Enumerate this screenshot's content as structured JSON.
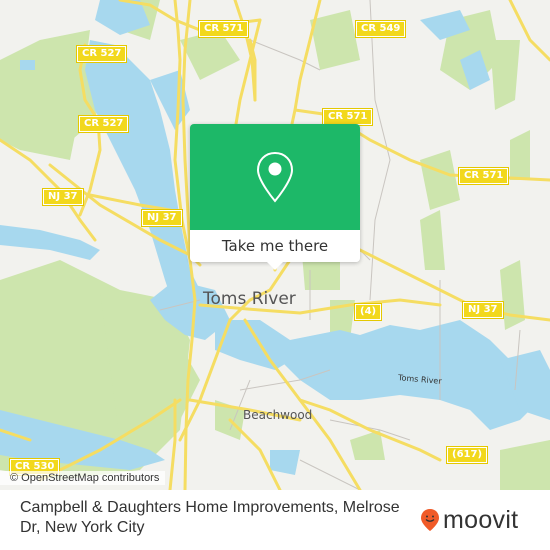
{
  "map": {
    "colors": {
      "land": "#f2f2ee",
      "water": "#a7d8ee",
      "park": "#cde5ad",
      "road": "#f5dd62",
      "minor_road": "#c9c5c0",
      "shield": "#f2d81c"
    },
    "road_shields": [
      {
        "id": "cr527-top",
        "label": "CR 527"
      },
      {
        "id": "cr571-top",
        "label": "CR 571"
      },
      {
        "id": "cr549",
        "label": "CR 549"
      },
      {
        "id": "cr527-mid",
        "label": "CR 527"
      },
      {
        "id": "cr571-mid",
        "label": "CR 571"
      },
      {
        "id": "cr571-right",
        "label": "CR 571"
      },
      {
        "id": "nj37-left",
        "label": "NJ 37"
      },
      {
        "id": "nj37-mid",
        "label": "NJ 37"
      },
      {
        "id": "nj37-right",
        "label": "NJ 37"
      },
      {
        "id": "route4",
        "label": "(4)"
      },
      {
        "id": "cr530",
        "label": "CR 530"
      },
      {
        "id": "route617",
        "label": "(617)"
      }
    ],
    "places": {
      "city": "Toms River",
      "town": "Beachwood",
      "water": "Toms River"
    },
    "attribution": "© OpenStreetMap contributors"
  },
  "popup": {
    "icon": "map-pin-icon",
    "button_label": "Take me there",
    "color": "#1db868"
  },
  "footer": {
    "title": "Campbell & Daughters Home Improvements, Melrose Dr, New York City",
    "brand": "moovit",
    "brand_color": "#f05a28"
  }
}
